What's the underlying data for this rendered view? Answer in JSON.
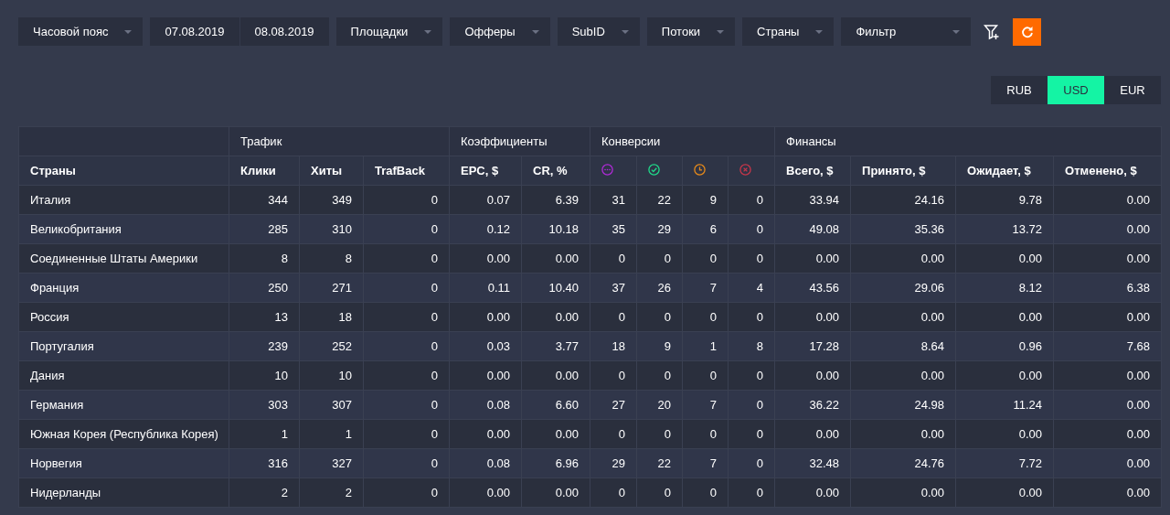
{
  "toolbar": [
    {
      "kind": "dropdown",
      "label": "Часовой пояс"
    },
    {
      "kind": "date",
      "label": "07.08.2019"
    },
    {
      "kind": "date",
      "label": "08.08.2019"
    },
    {
      "kind": "dropdown",
      "label": "Площадки"
    },
    {
      "kind": "dropdown",
      "label": "Офферы"
    },
    {
      "kind": "dropdown",
      "label": "SubID"
    },
    {
      "kind": "dropdown",
      "label": "Потоки"
    },
    {
      "kind": "dropdown",
      "label": "Страны"
    },
    {
      "kind": "wide",
      "label": "Фильтр"
    }
  ],
  "currencies": [
    {
      "label": "RUB",
      "selected": false
    },
    {
      "label": "USD",
      "selected": true
    },
    {
      "label": "EUR",
      "selected": false
    }
  ],
  "groups": [
    {
      "columns": [
        {
          "kind": "text",
          "label": "Страны"
        }
      ]
    },
    {
      "label": "Трафик",
      "columns": [
        {
          "kind": "text",
          "label": "Клики"
        },
        {
          "kind": "text",
          "label": "Хиты"
        },
        {
          "kind": "text",
          "label": "TrafBack"
        }
      ]
    },
    {
      "label": "Коэффициенты",
      "columns": [
        {
          "kind": "text",
          "label": "EPC, $"
        },
        {
          "kind": "text",
          "label": "CR, %"
        }
      ]
    },
    {
      "label": "Конверсии",
      "columns": [
        {
          "kind": "pending"
        },
        {
          "kind": "approved"
        },
        {
          "kind": "hold"
        },
        {
          "kind": "rejected"
        }
      ]
    },
    {
      "label": "Финансы",
      "columns": [
        {
          "kind": "text",
          "label": "Всего, $"
        },
        {
          "kind": "text",
          "label": "Принято, $"
        },
        {
          "kind": "text",
          "label": "Ожидает, $"
        },
        {
          "kind": "text",
          "label": "Отменено, $"
        }
      ]
    }
  ],
  "rows": [
    [
      "Италия",
      "344",
      "349",
      "0",
      "0.07",
      "6.39",
      "31",
      "22",
      "9",
      "0",
      "33.94",
      "24.16",
      "9.78",
      "0.00"
    ],
    [
      "Великобритания",
      "285",
      "310",
      "0",
      "0.12",
      "10.18",
      "35",
      "29",
      "6",
      "0",
      "49.08",
      "35.36",
      "13.72",
      "0.00"
    ],
    [
      "Соединенные Штаты Америки",
      "8",
      "8",
      "0",
      "0.00",
      "0.00",
      "0",
      "0",
      "0",
      "0",
      "0.00",
      "0.00",
      "0.00",
      "0.00"
    ],
    [
      "Франция",
      "250",
      "271",
      "0",
      "0.11",
      "10.40",
      "37",
      "26",
      "7",
      "4",
      "43.56",
      "29.06",
      "8.12",
      "6.38"
    ],
    [
      "Россия",
      "13",
      "18",
      "0",
      "0.00",
      "0.00",
      "0",
      "0",
      "0",
      "0",
      "0.00",
      "0.00",
      "0.00",
      "0.00"
    ],
    [
      "Португалия",
      "239",
      "252",
      "0",
      "0.03",
      "3.77",
      "18",
      "9",
      "1",
      "8",
      "17.28",
      "8.64",
      "0.96",
      "7.68"
    ],
    [
      "Дания",
      "10",
      "10",
      "0",
      "0.00",
      "0.00",
      "0",
      "0",
      "0",
      "0",
      "0.00",
      "0.00",
      "0.00",
      "0.00"
    ],
    [
      "Германия",
      "303",
      "307",
      "0",
      "0.08",
      "6.60",
      "27",
      "20",
      "7",
      "0",
      "36.22",
      "24.98",
      "11.24",
      "0.00"
    ],
    [
      "Южная Корея (Республика Корея)",
      "1",
      "1",
      "0",
      "0.00",
      "0.00",
      "0",
      "0",
      "0",
      "0",
      "0.00",
      "0.00",
      "0.00",
      "0.00"
    ],
    [
      "Норвегия",
      "316",
      "327",
      "0",
      "0.08",
      "6.96",
      "29",
      "22",
      "7",
      "0",
      "32.48",
      "24.76",
      "7.72",
      "0.00"
    ],
    [
      "Нидерланды",
      "2",
      "2",
      "0",
      "0.00",
      "0.00",
      "0",
      "0",
      "0",
      "0",
      "0.00",
      "0.00",
      "0.00",
      "0.00"
    ]
  ]
}
